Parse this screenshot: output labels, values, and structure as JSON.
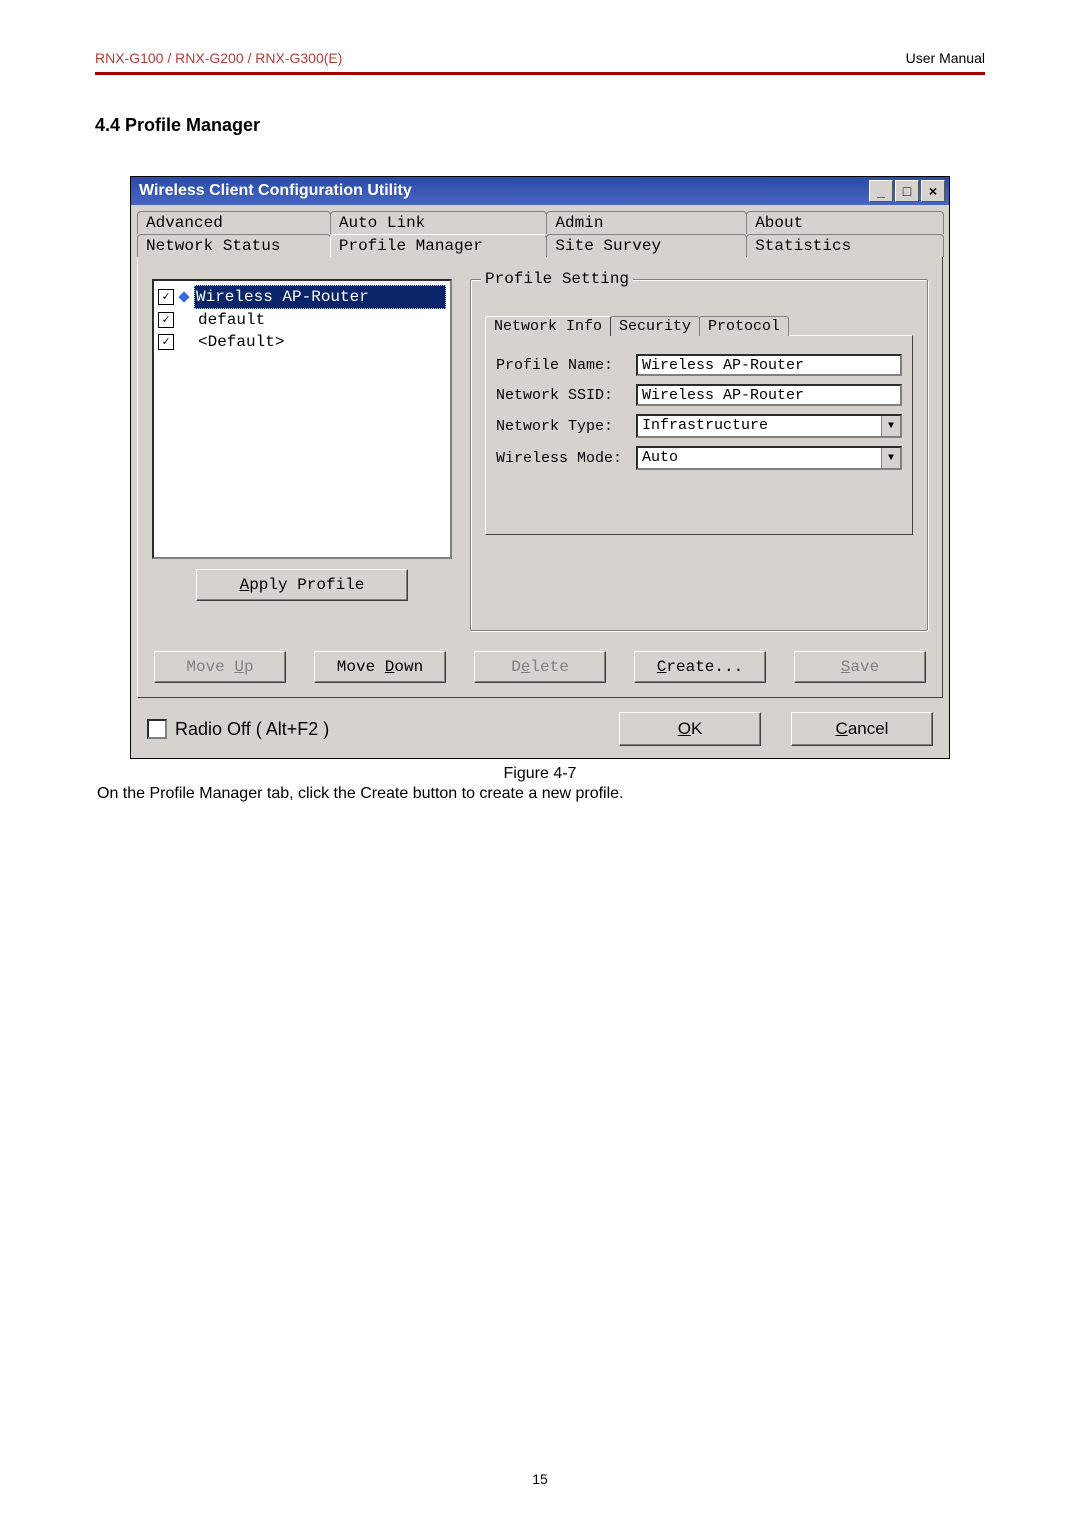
{
  "header": {
    "left": "RNX-G100  /  RNX-G200  /  RNX-G300(E)",
    "right": "User  Manual"
  },
  "section_heading": "4.4 Profile Manager",
  "window": {
    "title": "Wireless Client Configuration Utility",
    "win_buttons": [
      "_",
      "□",
      "×"
    ],
    "tabs_row1": [
      "Advanced",
      "Auto Link",
      "Admin",
      "About"
    ],
    "tabs_row2": [
      "Network Status",
      "Profile Manager",
      "Site Survey",
      "Statistics"
    ],
    "active_tab": "Profile Manager",
    "profile_list": [
      {
        "checked": true,
        "marker": true,
        "label": "Wireless AP-Router",
        "selected": true
      },
      {
        "checked": true,
        "marker": false,
        "label": "default",
        "selected": false,
        "indent": true
      },
      {
        "checked": true,
        "marker": false,
        "label": "<Default>",
        "selected": false,
        "indent": true
      }
    ],
    "apply_profile_btn": "Apply Profile",
    "groupbox_legend": "Profile Setting",
    "inner_tabs": [
      "Network Info",
      "Security",
      "Protocol"
    ],
    "inner_active": "Network Info",
    "fields": {
      "profile_name_label": "Profile Name:",
      "profile_name_value": "Wireless AP-Router",
      "network_ssid_label": "Network SSID:",
      "network_ssid_value": "Wireless AP-Router",
      "network_type_label": "Network Type:",
      "network_type_value": "Infrastructure",
      "wireless_mode_label": "Wireless Mode:",
      "wireless_mode_value": "Auto"
    },
    "buttons": {
      "move_up": "Move Up",
      "move_down": "Move Down",
      "delete": "Delete",
      "create": "Create...",
      "save": "Save"
    },
    "footer": {
      "radio_off": "Radio Off  ( Alt+F2 )",
      "ok": "OK",
      "cancel": "Cancel"
    }
  },
  "figure_caption": "Figure 4-7",
  "body_text": "On the Profile Manager tab, click the Create button to create a new profile.",
  "page_number": "15"
}
